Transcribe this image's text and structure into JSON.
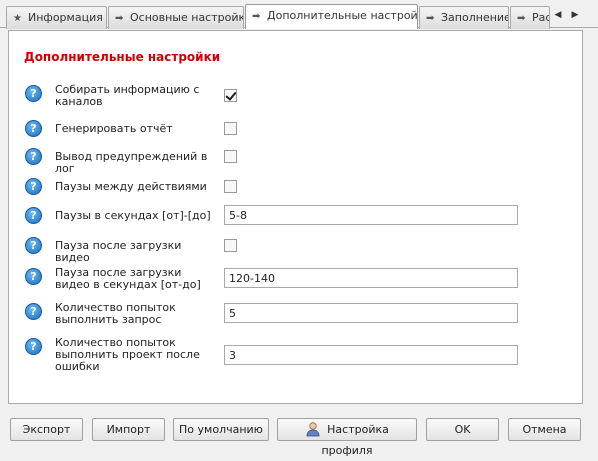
{
  "tabs": [
    {
      "label": "Информация",
      "icon": "star-icon",
      "glyph": "★"
    },
    {
      "label": "Основные настройки",
      "icon": "arrow-right-icon",
      "glyph": "➡"
    },
    {
      "label": "Дополнительные настройки",
      "icon": "arrow-right-icon",
      "glyph": "➡",
      "active": true
    },
    {
      "label": "Заполнение",
      "icon": "arrow-right-icon",
      "glyph": "➡"
    },
    {
      "label": "Рас",
      "icon": "arrow-right-icon",
      "glyph": "➡"
    }
  ],
  "tab_scroll": {
    "left": "◀",
    "right": "▶"
  },
  "section": {
    "title": "Дополнительные настройки",
    "title_color": "#d10000"
  },
  "help_glyph": "?",
  "settings": [
    {
      "label": "Собирать информацию с каналов",
      "type": "checkbox",
      "checked": true
    },
    {
      "label": "Генерировать отчёт",
      "type": "checkbox",
      "checked": false
    },
    {
      "label": "Вывод предупреждений в лог",
      "type": "checkbox",
      "checked": false
    },
    {
      "label": "Паузы между действиями",
      "type": "checkbox",
      "checked": false
    },
    {
      "label": "Паузы в секундах [от]-[до]",
      "type": "text",
      "value": "5-8"
    },
    {
      "label": "Пауза после загрузки видео",
      "type": "checkbox",
      "checked": false
    },
    {
      "label": "Пауза после загрузки видео в секундах [от-до]",
      "type": "text",
      "value": "120-140"
    },
    {
      "label": "Количество попыток выполнить запрос",
      "type": "text",
      "value": "5"
    },
    {
      "label": "Количество попыток выполнить проект после ошибки",
      "type": "text",
      "value": "3"
    }
  ],
  "footer": {
    "export": "Экспорт",
    "import": "Импорт",
    "default": "По умолчанию",
    "profile": "Настройка профиля",
    "ok": "OK",
    "cancel": "Отмена"
  }
}
